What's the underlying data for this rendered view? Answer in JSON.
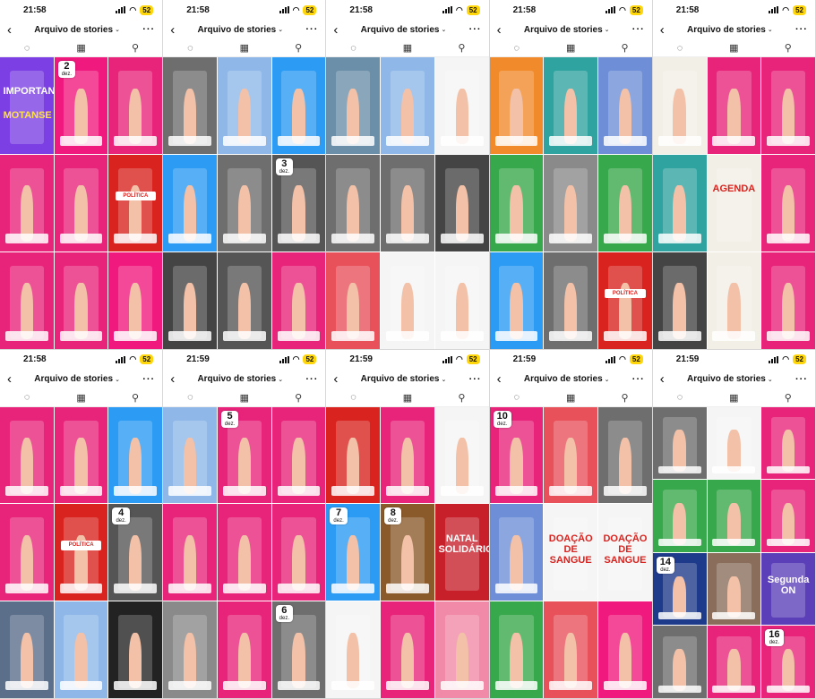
{
  "status": {
    "time1": "21:58",
    "time2": "21:59",
    "battery": "52"
  },
  "nav": {
    "title": "Arquivo de stories",
    "back_glyph": "‹",
    "more_glyph": "···",
    "chevron": "⌄"
  },
  "tabs": [
    {
      "name": "stories",
      "glyph": "◌"
    },
    {
      "name": "calendar",
      "glyph": "▦"
    },
    {
      "name": "map",
      "glyph": "⚲"
    }
  ],
  "colors": {
    "pink": "#e8237a",
    "hotpink": "#f0197d",
    "purple": "#7b3fe4",
    "blue": "#2b9bf4",
    "gray": "#6e6e6e",
    "teal": "#2fa3a0",
    "orange": "#f08a2b",
    "red": "#d8231f",
    "green": "#38a84c",
    "cream": "#f2efe6"
  },
  "phones": [
    {
      "time": "21:58",
      "thumbs": [
        {
          "bg": "#7b3fe4",
          "text": "IMPORTANTE",
          "text2": "MOTANSE"
        },
        {
          "bg": "#f0197d",
          "badge": {
            "day": "2",
            "month": "dez."
          }
        },
        {
          "bg": "#e8237a"
        },
        {
          "bg": "#e8237a"
        },
        {
          "bg": "#e8237a"
        },
        {
          "bg": "#d8231f",
          "chip": "POLÍTICA"
        },
        {
          "bg": "#e8237a"
        },
        {
          "bg": "#e8237a"
        },
        {
          "bg": "#f0197d"
        }
      ]
    },
    {
      "time": "21:58",
      "thumbs": [
        {
          "bg": "#6e6e6e"
        },
        {
          "bg": "#8fb8e8"
        },
        {
          "bg": "#2b9bf4"
        },
        {
          "bg": "#2b9bf4"
        },
        {
          "bg": "#6e6e6e"
        },
        {
          "bg": "#555",
          "badge": {
            "day": "3",
            "month": "dez."
          }
        },
        {
          "bg": "#444"
        },
        {
          "bg": "#555"
        },
        {
          "bg": "#e8237a"
        }
      ]
    },
    {
      "time": "21:58",
      "thumbs": [
        {
          "bg": "#6b8fa8"
        },
        {
          "bg": "#8fb8e8"
        },
        {
          "bg": "#f5f5f5"
        },
        {
          "bg": "#6e6e6e"
        },
        {
          "bg": "#6e6e6e"
        },
        {
          "bg": "#444"
        },
        {
          "bg": "#e8505a"
        },
        {
          "bg": "#f5f5f5"
        },
        {
          "bg": "#f5f5f5"
        }
      ]
    },
    {
      "time": "21:58",
      "thumbs": [
        {
          "bg": "#f08a2b"
        },
        {
          "bg": "#2fa3a0"
        },
        {
          "bg": "#6e8fd8"
        },
        {
          "bg": "#38a84c"
        },
        {
          "bg": "#8a8a8a"
        },
        {
          "bg": "#38a84c"
        },
        {
          "bg": "#2b9bf4"
        },
        {
          "bg": "#6e6e6e"
        },
        {
          "bg": "#d8231f",
          "chip": "POLÍTICA"
        }
      ]
    },
    {
      "time": "21:58",
      "thumbs": [
        {
          "bg": "#f2efe6"
        },
        {
          "bg": "#e8237a"
        },
        {
          "bg": "#e8237a"
        },
        {
          "bg": "#2fa3a0"
        },
        {
          "bg": "#f2efe6",
          "text": "AGENDA"
        },
        {
          "bg": "#e8237a"
        },
        {
          "bg": "#444"
        },
        {
          "bg": "#f2efe6"
        },
        {
          "bg": "#e8237a"
        }
      ]
    },
    {
      "time": "21:58",
      "thumbs": [
        {
          "bg": "#e8237a"
        },
        {
          "bg": "#e8237a"
        },
        {
          "bg": "#2b9bf4"
        },
        {
          "bg": "#e8237a"
        },
        {
          "bg": "#d8231f",
          "chip": "POLÍTICA"
        },
        {
          "bg": "#555",
          "badge": {
            "day": "4",
            "month": "dez."
          }
        },
        {
          "bg": "#5b6e8a"
        },
        {
          "bg": "#8fb8e8"
        },
        {
          "bg": "#222"
        }
      ]
    },
    {
      "time": "21:59",
      "thumbs": [
        {
          "bg": "#8fb8e8"
        },
        {
          "bg": "#e8237a",
          "badge": {
            "day": "5",
            "month": "dez."
          }
        },
        {
          "bg": "#e8237a"
        },
        {
          "bg": "#e8237a"
        },
        {
          "bg": "#e8237a"
        },
        {
          "bg": "#e8237a"
        },
        {
          "bg": "#8a8a8a"
        },
        {
          "bg": "#e8237a"
        },
        {
          "bg": "#6e6e6e",
          "badge": {
            "day": "6",
            "month": "dez."
          }
        }
      ]
    },
    {
      "time": "21:59",
      "thumbs": [
        {
          "bg": "#d8231f"
        },
        {
          "bg": "#e8237a"
        },
        {
          "bg": "#f5f5f5"
        },
        {
          "bg": "#2b9bf4",
          "badge": {
            "day": "7",
            "month": "dez."
          }
        },
        {
          "bg": "#8b5a2b",
          "badge": {
            "day": "8",
            "month": "dez."
          }
        },
        {
          "bg": "#c8202a",
          "text": "NATAL SOLIDÁRIO"
        },
        {
          "bg": "#f5f5f5"
        },
        {
          "bg": "#e8237a"
        },
        {
          "bg": "#f08aa8"
        }
      ]
    },
    {
      "time": "21:59",
      "thumbs": [
        {
          "bg": "#e8237a",
          "badge": {
            "day": "10",
            "month": "dez."
          }
        },
        {
          "bg": "#e8505a"
        },
        {
          "bg": "#6e6e6e"
        },
        {
          "bg": "#6e8fd8"
        },
        {
          "bg": "#f5f5f5",
          "text": "DOAÇÃO DE SANGUE"
        },
        {
          "bg": "#f5f5f5",
          "text": "DOAÇÃO DE SANGUE"
        },
        {
          "bg": "#38a84c"
        },
        {
          "bg": "#e8505a"
        },
        {
          "bg": "#f0197d"
        }
      ]
    },
    {
      "time": "21:59",
      "thumbs": [
        {
          "bg": "#6e6e6e"
        },
        {
          "bg": "#f5f5f5"
        },
        {
          "bg": "#e8237a"
        },
        {
          "bg": "#38a84c"
        },
        {
          "bg": "#38a84c"
        },
        {
          "bg": "#e8237a"
        },
        {
          "bg": "#1e3a8a",
          "badge": {
            "day": "14",
            "month": "dez."
          }
        },
        {
          "bg": "#8a6e5b"
        },
        {
          "bg": "#5b3fb8",
          "text": "Segunda ON"
        },
        {
          "bg": "#6e6e6e"
        },
        {
          "bg": "#e8237a"
        },
        {
          "bg": "#e8237a",
          "badge": {
            "day": "16",
            "month": "dez."
          }
        }
      ]
    }
  ]
}
